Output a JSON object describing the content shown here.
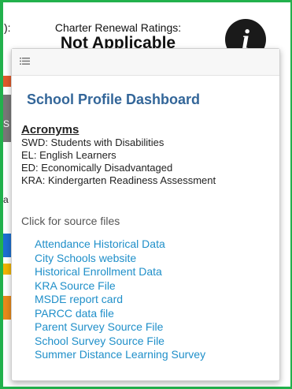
{
  "background": {
    "left_fragment": "):",
    "rating_label": "Charter Renewal Ratings:",
    "rating_value": "Not Applicable",
    "info_icon": "info-icon",
    "side_letters": [
      "S",
      "a"
    ]
  },
  "popover": {
    "menu_icon": "list-icon",
    "title": "School Profile Dashboard",
    "acronyms": {
      "heading": "Acronyms",
      "items": [
        "SWD: Students with Disabilities",
        "EL: English Learners",
        "ED: Economically Disadvantaged",
        "KRA: Kindergarten Readiness Assessment"
      ]
    },
    "source_label": "Click for source files",
    "links": [
      "Attendance Historical Data",
      "City Schools website",
      "Historical Enrollment Data",
      "KRA Source File",
      "MSDE report card",
      "PARCC data file",
      "Parent Survey Source File",
      "School Survey Source File",
      "Summer Distance Learning Survey"
    ]
  },
  "colors": {
    "frame": "#22b14c",
    "title": "#336699",
    "link": "#1f8fc9"
  }
}
